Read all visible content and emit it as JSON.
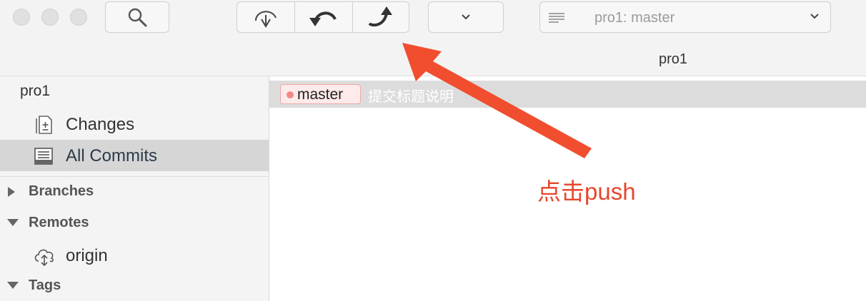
{
  "window": {
    "title": "pro1"
  },
  "toolbar": {
    "repo_selector_label": "pro1: master"
  },
  "sidebar": {
    "repo_name": "pro1",
    "items": [
      {
        "label": "Changes",
        "icon": "changes-icon"
      },
      {
        "label": "All Commits",
        "icon": "commits-icon",
        "selected": true
      }
    ],
    "sections": {
      "branches": "Branches",
      "remotes": "Remotes",
      "tags": "Tags"
    },
    "remotes": [
      {
        "label": "origin",
        "icon": "cloud-icon"
      }
    ]
  },
  "commits": [
    {
      "branch": "master",
      "title": "提交标题说明"
    }
  ],
  "annotation": {
    "text": "点击push",
    "color": "#e8462d"
  },
  "colors": {
    "selection": "#d6d6d6",
    "branch_tag_bg": "#fdeaea",
    "branch_tag_border": "#f0a7a7"
  }
}
